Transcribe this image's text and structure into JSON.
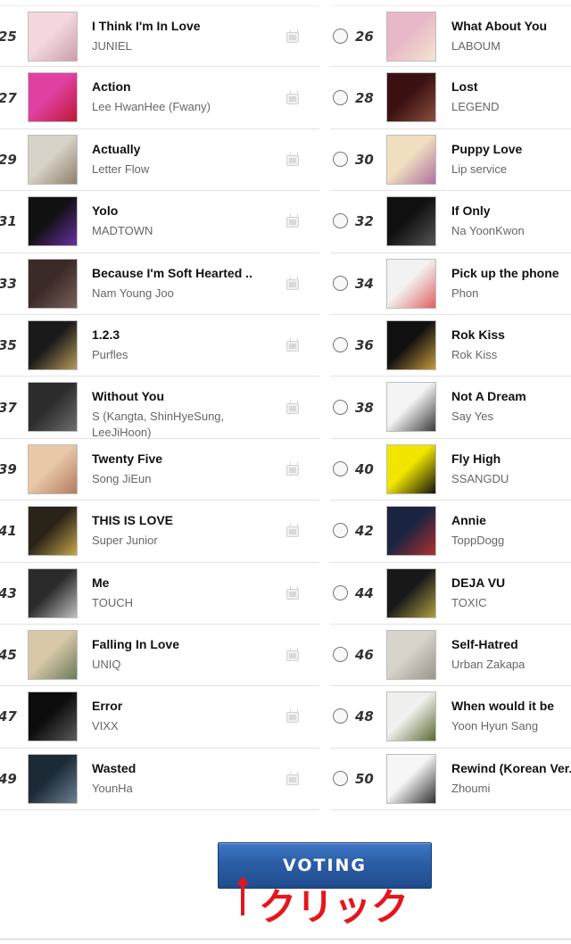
{
  "left_column": [
    {
      "rank": "25",
      "title": "I Think I'm In Love",
      "artist": "JUNIEL",
      "has_mv": true,
      "art_colors": [
        "#f5d7de",
        "#c9a0a8"
      ]
    },
    {
      "rank": "27",
      "title": "Action",
      "artist": "Lee HwanHee (Fwany)",
      "has_mv": true,
      "art_colors": [
        "#e040a0",
        "#c01838"
      ]
    },
    {
      "rank": "29",
      "title": "Actually",
      "artist": "Letter Flow",
      "has_mv": true,
      "art_colors": [
        "#d8d3c8",
        "#8e806c"
      ]
    },
    {
      "rank": "31",
      "title": "Yolo",
      "artist": "MADTOWN",
      "has_mv": true,
      "art_colors": [
        "#111111",
        "#6a2fa0"
      ]
    },
    {
      "rank": "33",
      "title": "Because I'm Soft Hearted ..",
      "artist": "Nam Young Joo",
      "has_mv": true,
      "art_colors": [
        "#3a2a28",
        "#7a5f58"
      ]
    },
    {
      "rank": "35",
      "title": "1.2.3",
      "artist": "Purfles",
      "has_mv": true,
      "art_colors": [
        "#1a1a1a",
        "#b89a5a"
      ]
    },
    {
      "rank": "37",
      "title": "Without You",
      "artist": "S (Kangta, ShinHyeSung, LeeJiHoon)",
      "has_mv": true,
      "art_colors": [
        "#2c2c2c",
        "#6d6d6d"
      ]
    },
    {
      "rank": "39",
      "title": "Twenty Five",
      "artist": "Song JiEun",
      "has_mv": true,
      "art_colors": [
        "#e9c8a8",
        "#b37b60"
      ]
    },
    {
      "rank": "41",
      "title": "THIS IS LOVE",
      "artist": "Super Junior",
      "has_mv": true,
      "art_colors": [
        "#2a2418",
        "#c7a64a"
      ]
    },
    {
      "rank": "43",
      "title": "Me",
      "artist": "TOUCH",
      "has_mv": true,
      "art_colors": [
        "#2b2b2b",
        "#bfbfbf"
      ]
    },
    {
      "rank": "45",
      "title": "Falling In Love",
      "artist": "UNIQ",
      "has_mv": true,
      "art_colors": [
        "#d8c8a8",
        "#6b7a5a"
      ]
    },
    {
      "rank": "47",
      "title": "Error",
      "artist": "VIXX",
      "has_mv": true,
      "art_colors": [
        "#0c0c0c",
        "#5a5a5a"
      ]
    },
    {
      "rank": "49",
      "title": "Wasted",
      "artist": "YounHa",
      "has_mv": true,
      "art_colors": [
        "#1c2a36",
        "#6b7f92"
      ]
    }
  ],
  "right_column": [
    {
      "rank": "26",
      "title": "What About You",
      "artist": "LABOUM",
      "art_colors": [
        "#e8b8c8",
        "#f4e4d0"
      ]
    },
    {
      "rank": "28",
      "title": "Lost",
      "artist": "LEGEND",
      "art_colors": [
        "#3a1010",
        "#8a5040"
      ]
    },
    {
      "rank": "30",
      "title": "Puppy Love",
      "artist": "Lip service",
      "art_colors": [
        "#f0e0c0",
        "#b070a0"
      ]
    },
    {
      "rank": "32",
      "title": "If Only",
      "artist": "Na YoonKwon",
      "art_colors": [
        "#111111",
        "#555555"
      ]
    },
    {
      "rank": "34",
      "title": "Pick up the phone",
      "artist": "Phon",
      "art_colors": [
        "#f2f2f2",
        "#e06060"
      ]
    },
    {
      "rank": "36",
      "title": "Rok Kiss",
      "artist": "Rok Kiss",
      "art_colors": [
        "#101010",
        "#c89a3a"
      ]
    },
    {
      "rank": "38",
      "title": "Not A Dream",
      "artist": "Say Yes",
      "art_colors": [
        "#f4f4f4",
        "#3a3a3a"
      ]
    },
    {
      "rank": "40",
      "title": "Fly High",
      "artist": "SSANGDU",
      "art_colors": [
        "#f2e600",
        "#111111"
      ]
    },
    {
      "rank": "42",
      "title": "Annie",
      "artist": "ToppDogg",
      "art_colors": [
        "#1a2440",
        "#b03030"
      ]
    },
    {
      "rank": "44",
      "title": "DEJA VU",
      "artist": "TOXIC",
      "art_colors": [
        "#181818",
        "#b0a040"
      ]
    },
    {
      "rank": "46",
      "title": "Self-Hatred",
      "artist": "Urban Zakapa",
      "art_colors": [
        "#d8d4cc",
        "#9a948a"
      ]
    },
    {
      "rank": "48",
      "title": "When would it be",
      "artist": "Yoon Hyun Sang",
      "art_colors": [
        "#f0f0ee",
        "#5a6a30"
      ]
    },
    {
      "rank": "50",
      "title": "Rewind (Korean Ver.)",
      "artist": "Zhoumi",
      "art_colors": [
        "#f6f6f6",
        "#303030"
      ]
    }
  ],
  "vote": {
    "button_label": "VOTING",
    "annotation_text": "クリック",
    "annotation_color": "#e6151c"
  }
}
